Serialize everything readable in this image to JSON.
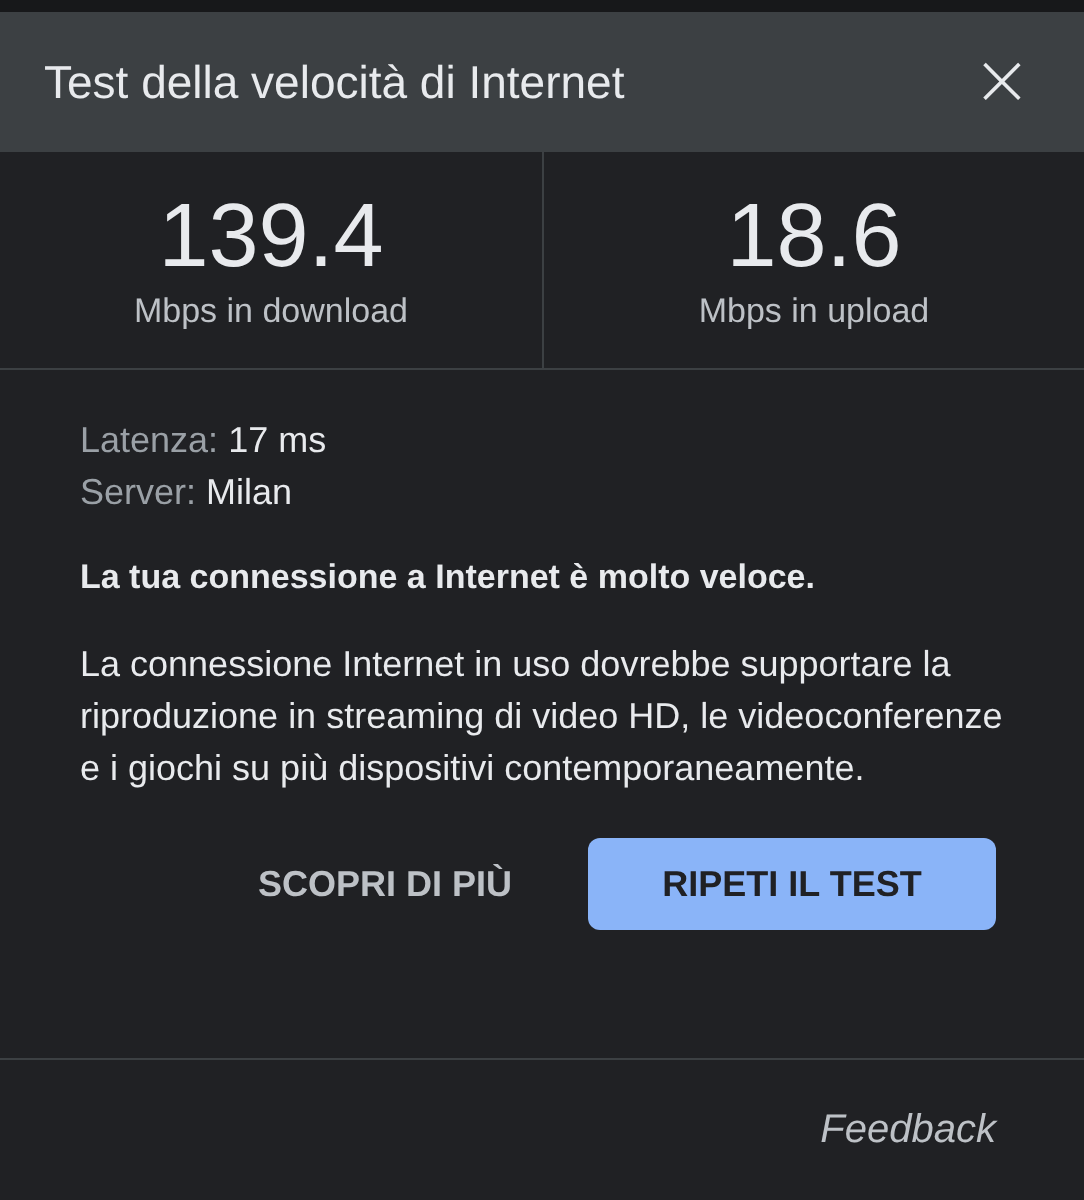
{
  "dialog": {
    "title": "Test della velocità di Internet",
    "close": "×"
  },
  "metrics": [
    {
      "value": "139.4",
      "label": "Mbps in download"
    },
    {
      "value": "18.6",
      "label": "Mbps in upload"
    }
  ],
  "details": [
    {
      "label": "Latenza:",
      "value": "17 ms"
    },
    {
      "label": "Server:",
      "value": "Milan"
    }
  ],
  "verdict": "La tua connessione a Internet è molto veloce.",
  "description": "La connessione Internet in uso dovrebbe supportare la riproduzione in streaming di video HD, le videoconferenze e i giochi su più dispositivi contemporaneamente.",
  "buttons": [
    {
      "label": "SCOPRI DI PIÙ",
      "kind": "text"
    },
    {
      "label": "RIPETI IL TEST",
      "kind": "filled"
    }
  ],
  "footer_link": "Feedback"
}
